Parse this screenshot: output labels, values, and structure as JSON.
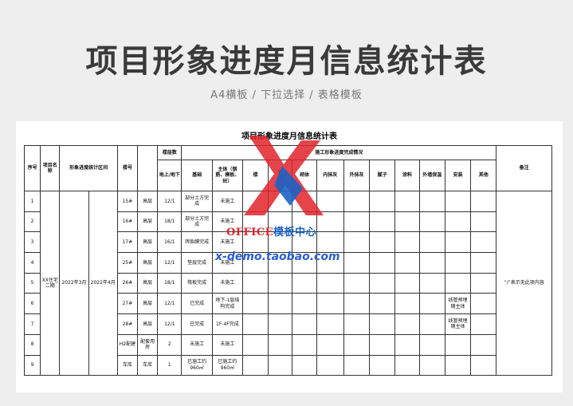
{
  "header": {
    "title": "项目形象进度月信息统计表",
    "subtitle": "A4横板 / 下拉选择 / 表格模板"
  },
  "sheet": {
    "title": "项目形象进度月信息统计表",
    "headers": {
      "seq": "序号",
      "project": "项目名称",
      "period": "形象进度统计区间",
      "building": "楼号",
      "floors": "楼层数",
      "floors_sub": "地上/地下",
      "progress": "施工形象进度完成情况",
      "foundation": "基础",
      "main": "主体（钢筋、模板、砼）",
      "c3": "楼",
      "c4": "找",
      "c4b": "坡",
      "c5": "砌体",
      "c6": "内抹灰",
      "c7": "外抹灰",
      "c8": "腻子",
      "c9": "涂料",
      "c10": "外墙保温",
      "c11": "安装",
      "c12": "其他",
      "remark": "备注"
    },
    "merged": {
      "project": "XX住宅二期",
      "period_start": "2022年3月",
      "period_end": "2022年4月",
      "remark": "“/”表示无此项内容"
    },
    "rows": [
      {
        "seq": "1",
        "building": "15#",
        "type": "高层",
        "floors": "12/1",
        "foundation": "部分土方完成",
        "main": "未施工",
        "install": ""
      },
      {
        "seq": "2",
        "building": "16#",
        "type": "高层",
        "floors": "18/1",
        "foundation": "部分土方完成",
        "main": "未施工",
        "install": ""
      },
      {
        "seq": "3",
        "building": "17#",
        "type": "高层",
        "floors": "16/1",
        "foundation": "砖胎膜完成",
        "main": "未施工",
        "install": ""
      },
      {
        "seq": "4",
        "building": "25#",
        "type": "高层",
        "floors": "12/1",
        "foundation": "垫层完成",
        "main": "未施工",
        "install": ""
      },
      {
        "seq": "5",
        "building": "26#",
        "type": "高层",
        "floors": "18/1",
        "foundation": "筏板完成",
        "main": "未施工",
        "install": ""
      },
      {
        "seq": "6",
        "building": "27#",
        "type": "高层",
        "floors": "12/1",
        "foundation": "已完成",
        "main": "地下-1层结构完成",
        "install": "线管预埋随主体"
      },
      {
        "seq": "7",
        "building": "28#",
        "type": "高层",
        "floors": "12/1",
        "foundation": "已完成",
        "main": "1F-4F完成",
        "install": "线管预埋随主体"
      },
      {
        "seq": "8",
        "building": "H2配建",
        "type": "配套用房",
        "floors": "2",
        "foundation": "未施工",
        "main": "未施工",
        "install": ""
      },
      {
        "seq": "9",
        "building": "车库",
        "type": "车库",
        "floors": "1",
        "foundation": "已施工约960㎡",
        "main": "已施工约960㎡",
        "install": ""
      }
    ]
  },
  "watermark": {
    "brand_en": "OFFICE",
    "brand_cn": "模板中心",
    "url": "x-demo.taobao.com"
  },
  "colors": {
    "background": "#eeeeee",
    "watermark_red": "#e0232a",
    "watermark_blue": "#1c63c6"
  }
}
